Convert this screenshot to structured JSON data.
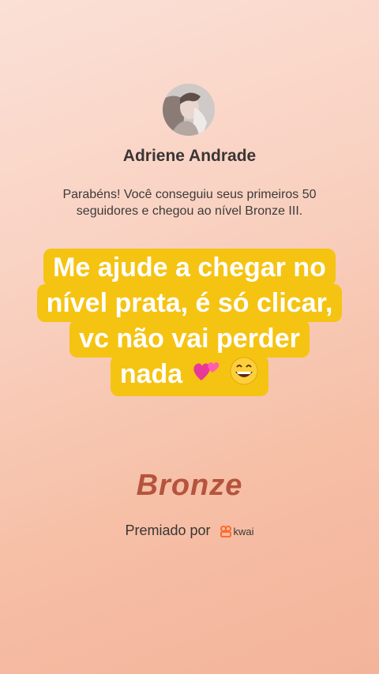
{
  "profile": {
    "name": "Adriene Andrade",
    "message": "Parabéns! Você conseguiu seus primeiros 50 seguidores e chegou ao nível Bronze III."
  },
  "overlay_text": {
    "line1": "Me ajude a chegar no",
    "line2": "nível prata, é só clicar,",
    "line3": "vc não vai perder",
    "line4": "nada"
  },
  "level": {
    "name": "Bronze"
  },
  "awarded": {
    "label": "Premiado por",
    "brand": "kwai",
    "brand_color": "#ff6a2c"
  },
  "colors": {
    "overlay_bg": "#f5c312",
    "level_text": "#b5543d"
  },
  "icons": {
    "overlay_emojis": [
      "two-hearts-icon",
      "grinning-face-icon"
    ],
    "brand_logo": "kwai-logo-icon"
  }
}
